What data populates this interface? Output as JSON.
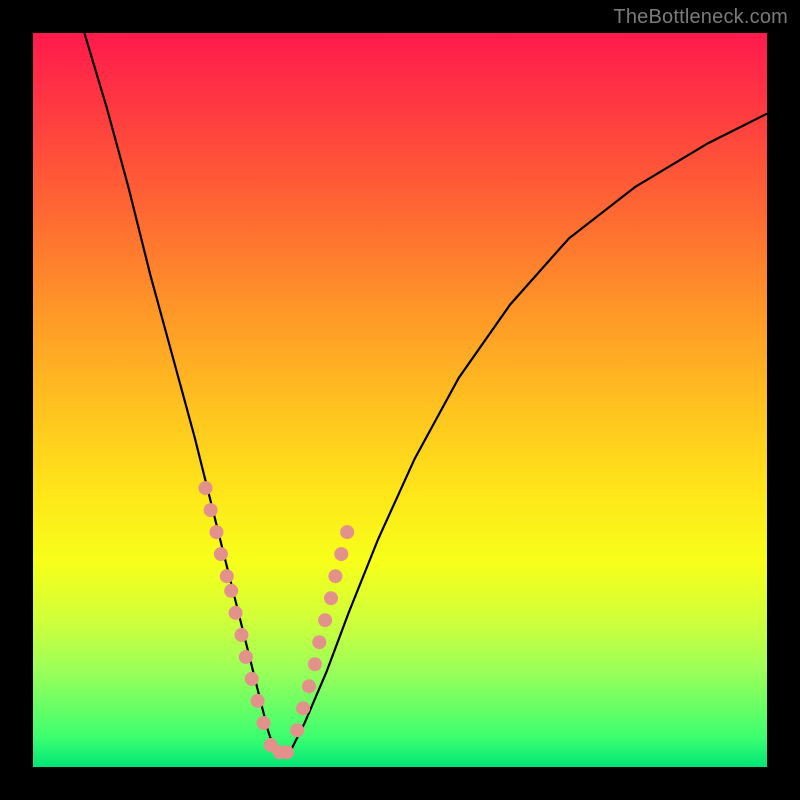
{
  "watermark": "TheBottleneck.com",
  "chart_data": {
    "type": "line",
    "title": "",
    "xlabel": "",
    "ylabel": "",
    "xlim": [
      0,
      100
    ],
    "ylim": [
      0,
      100
    ],
    "grid": false,
    "legend": false,
    "series": [
      {
        "name": "curve",
        "color": "#000000",
        "x": [
          7,
          10,
          13,
          16,
          19,
          22,
          24,
          26,
          28,
          30,
          31,
          32,
          33,
          35,
          37,
          40,
          43,
          47,
          52,
          58,
          65,
          73,
          82,
          92,
          100
        ],
        "y": [
          100,
          90,
          79,
          67,
          56,
          45,
          37,
          29,
          21,
          13,
          9,
          5,
          2,
          2,
          6,
          13,
          21,
          31,
          42,
          53,
          63,
          72,
          79,
          85,
          89
        ]
      }
    ],
    "scatter": {
      "name": "dots",
      "color": "#e3918b",
      "x": [
        23.5,
        24.2,
        25.0,
        25.6,
        26.4,
        27.0,
        27.6,
        28.4,
        29.0,
        29.8,
        30.6,
        31.4,
        32.4,
        33.6,
        34.6,
        36.0,
        36.8,
        37.6,
        38.4,
        39.0,
        39.8,
        40.6,
        41.2,
        42.0,
        42.8
      ],
      "y": [
        38,
        35,
        32,
        29,
        26,
        24,
        21,
        18,
        15,
        12,
        9,
        6,
        3,
        2,
        2,
        5,
        8,
        11,
        14,
        17,
        20,
        23,
        26,
        29,
        32
      ]
    },
    "background_gradient": {
      "direction": "top_to_bottom",
      "stops": [
        {
          "pos": 0.0,
          "color": "#ff1a4c"
        },
        {
          "pos": 0.5,
          "color": "#ffbf20"
        },
        {
          "pos": 0.8,
          "color": "#d0ff3a"
        },
        {
          "pos": 1.0,
          "color": "#00e676"
        }
      ]
    }
  }
}
